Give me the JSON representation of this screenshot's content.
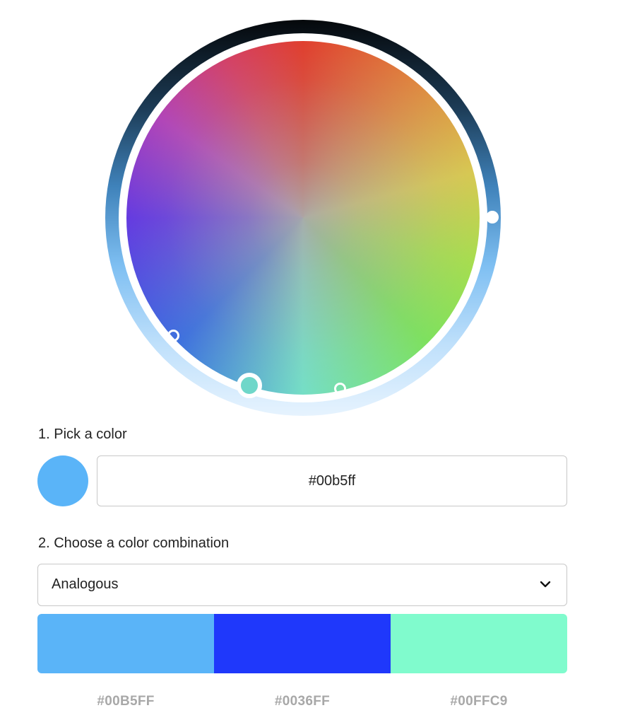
{
  "wheel": {
    "brightness_handle": "brightness-handle",
    "selected_handle": "selected-color-handle"
  },
  "step1": {
    "label": "1. Pick a color",
    "preview_color": "#5ab4f8",
    "hex_value": "#00b5ff"
  },
  "step2": {
    "label": "2. Choose a color combination",
    "combination": "Analogous",
    "dropdown_icon": "chevron-down-icon"
  },
  "palette": {
    "colors": [
      {
        "hex": "#00B5FF",
        "display": "#5ab4f8"
      },
      {
        "hex": "#0036FF",
        "display": "#1f38fb"
      },
      {
        "hex": "#00FFC9",
        "display": "#80fbcd"
      }
    ]
  }
}
